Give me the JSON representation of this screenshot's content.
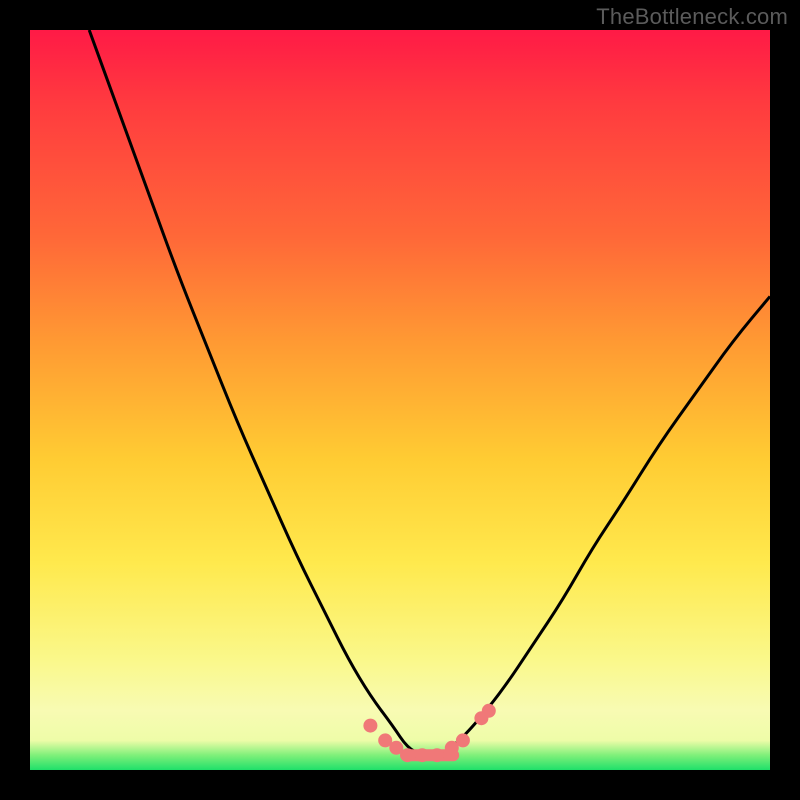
{
  "watermark": "TheBottleneck.com",
  "chart_data": {
    "type": "line",
    "title": "",
    "xlabel": "",
    "ylabel": "",
    "xlim": [
      0,
      100
    ],
    "ylim": [
      0,
      100
    ],
    "grid": false,
    "series": [
      {
        "name": "bottleneck-curve",
        "x": [
          8,
          12,
          16,
          20,
          24,
          28,
          32,
          36,
          40,
          43,
          46,
          49,
          51,
          53,
          55,
          57,
          60,
          64,
          68,
          72,
          76,
          80,
          85,
          90,
          95,
          100
        ],
        "values": [
          100,
          89,
          78,
          67,
          57,
          47,
          38,
          29,
          21,
          15,
          10,
          6,
          3,
          2,
          2,
          3,
          6,
          11,
          17,
          23,
          30,
          36,
          44,
          51,
          58,
          64
        ]
      }
    ],
    "markers": {
      "name": "highlight-dots",
      "color": "#f07878",
      "x": [
        46,
        48,
        49.5,
        51,
        53,
        55,
        57,
        58.5,
        61,
        62
      ],
      "values": [
        6,
        4,
        3,
        2,
        2,
        2,
        3,
        4,
        7,
        8
      ]
    },
    "flat_band": {
      "name": "min-plateau",
      "color": "#f07878",
      "x_start": 50,
      "x_end": 58,
      "value": 2
    }
  }
}
